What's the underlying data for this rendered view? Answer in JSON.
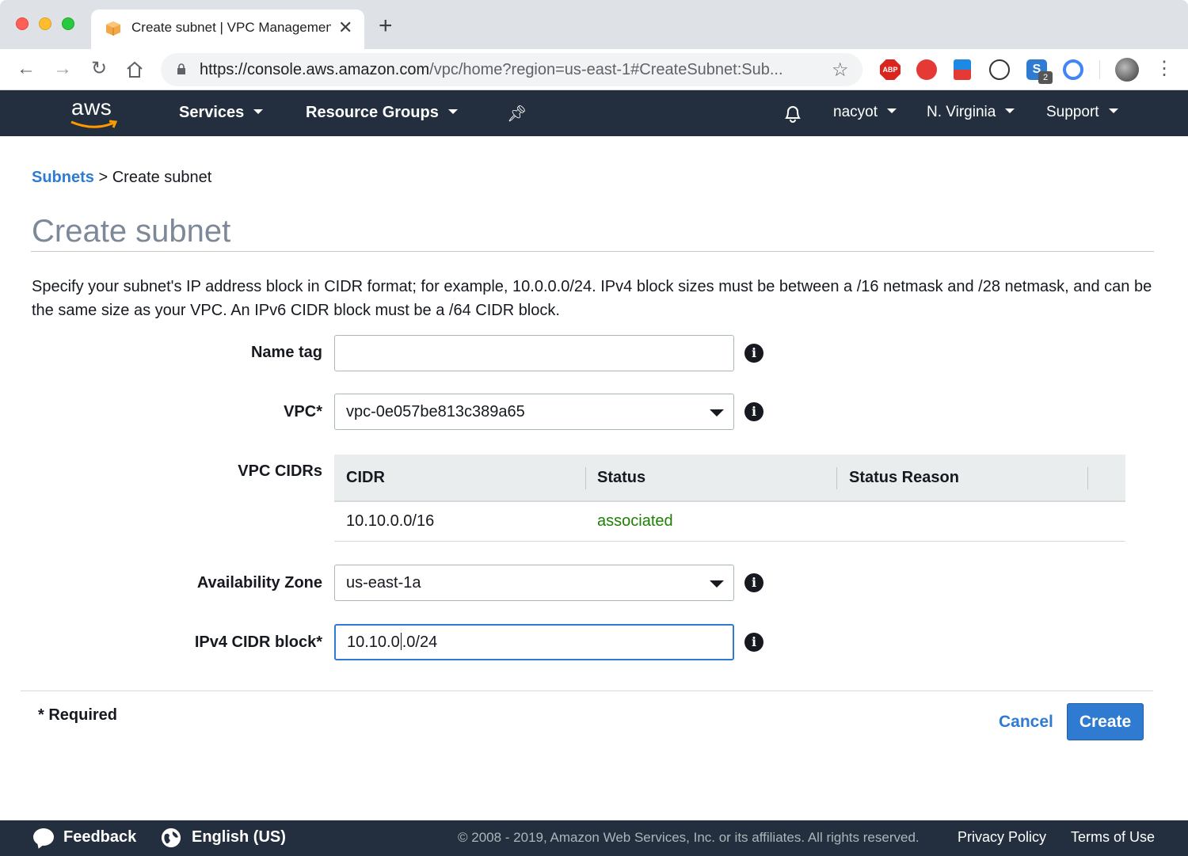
{
  "browser": {
    "tab_title": "Create subnet | VPC Management Console",
    "url_host": "https://console.aws.amazon.com",
    "url_path": "/vpc/home?region=us-east-1#CreateSubnet:Sub...",
    "ext_badge": "2",
    "abp_label": "ABP"
  },
  "awsnav": {
    "logo": "aws",
    "services": "Services",
    "resource_groups": "Resource Groups",
    "user": "nacyot",
    "region": "N. Virginia",
    "support": "Support"
  },
  "breadcrumb": {
    "parent": "Subnets",
    "separator": ">",
    "current": "Create subnet"
  },
  "page": {
    "title": "Create subnet",
    "description": "Specify your subnet's IP address block in CIDR format; for example, 10.0.0.0/24. IPv4 block sizes must be between a /16 netmask and /28 netmask, and can be the same size as your VPC. An IPv6 CIDR block must be a /64 CIDR block."
  },
  "form": {
    "name_tag": {
      "label": "Name tag",
      "value": ""
    },
    "vpc": {
      "label": "VPC*",
      "value": "vpc-0e057be813c389a65"
    },
    "vpc_cidrs": {
      "label": "VPC CIDRs",
      "columns": [
        "CIDR",
        "Status",
        "Status Reason"
      ],
      "rows": [
        {
          "cidr": "10.10.0.0/16",
          "status": "associated",
          "reason": ""
        }
      ]
    },
    "availability_zone": {
      "label": "Availability Zone",
      "value": "us-east-1a"
    },
    "ipv4_cidr": {
      "label": "IPv4 CIDR block*",
      "value_before_cursor": "10.10.0",
      "value_after_cursor": ".0/24"
    }
  },
  "actions": {
    "required_note": "* Required",
    "cancel": "Cancel",
    "create": "Create"
  },
  "footer": {
    "feedback": "Feedback",
    "language": "English (US)",
    "copyright": "© 2008 - 2019, Amazon Web Services, Inc. or its affiliates. All rights reserved.",
    "privacy": "Privacy Policy",
    "terms": "Terms of Use"
  },
  "colors": {
    "aws_nav": "#232f3e",
    "link_blue": "#2f7bd1",
    "status_green": "#1d8102"
  }
}
